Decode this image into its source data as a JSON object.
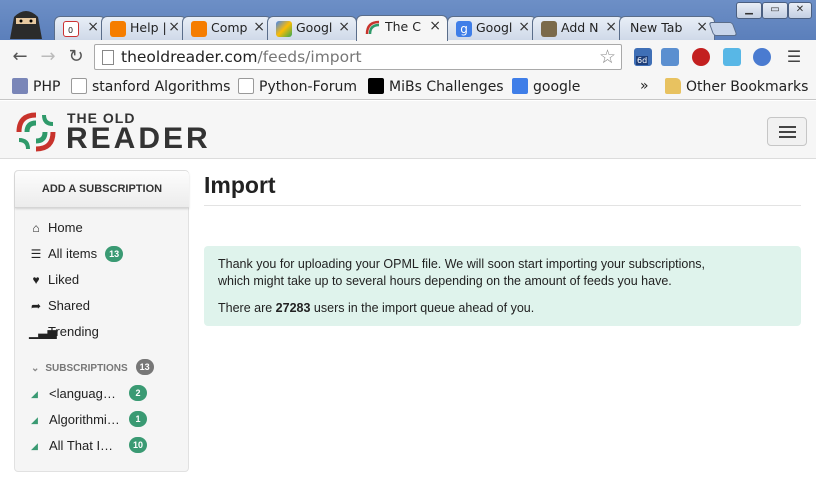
{
  "browser": {
    "tabs": [
      {
        "label": "",
        "favicon": "gmail-icon",
        "badge": "0"
      },
      {
        "label": "Help |",
        "favicon": "blogger-icon"
      },
      {
        "label": "Comp",
        "favicon": "blogger-icon"
      },
      {
        "label": "Googl",
        "favicon": "google-drive-icon"
      },
      {
        "label": "The C",
        "favicon": "oldreader-icon",
        "active": true
      },
      {
        "label": "Googl",
        "favicon": "google-icon"
      },
      {
        "label": "Add N",
        "favicon": "avatar-icon"
      },
      {
        "label": "New Tab",
        "favicon": ""
      }
    ],
    "url_host": "theoldreader.com",
    "url_path": "/feeds/import",
    "extension_badge": "6d",
    "bookmarks": [
      {
        "label": "PHP",
        "icon": "php-icon"
      },
      {
        "label": "stanford Algorithms",
        "icon": "stanford-icon"
      },
      {
        "label": "Python-Forum",
        "icon": "python-icon"
      },
      {
        "label": "MiBs Challenges",
        "icon": "mibs-icon"
      },
      {
        "label": "google",
        "icon": "google-icon"
      }
    ],
    "bookmarks_overflow": "»",
    "other_bookmarks": "Other Bookmarks"
  },
  "header": {
    "logo_small": "THE OLD",
    "logo_big": "READER"
  },
  "sidebar": {
    "add_subscription": "ADD A SUBSCRIPTION",
    "nav": [
      {
        "label": "Home",
        "icon": "home-icon"
      },
      {
        "label": "All items",
        "icon": "list-icon",
        "count": "13"
      },
      {
        "label": "Liked",
        "icon": "heart-icon"
      },
      {
        "label": "Shared",
        "icon": "share-icon"
      },
      {
        "label": "Trending",
        "icon": "signal-icon"
      }
    ],
    "subscriptions_label": "SUBSCRIPTIONS",
    "subscriptions_count": "13",
    "subscriptions": [
      {
        "label": "<languag…",
        "count": "2"
      },
      {
        "label": "Algorithmi…",
        "count": "1"
      },
      {
        "label": "All That I…",
        "count": "10"
      }
    ]
  },
  "main": {
    "title": "Import",
    "notice_line1": "Thank you for uploading your OPML file. We will soon start importing your subscriptions,",
    "notice_line2": "which might take up to several hours depending on the amount of feeds you have.",
    "queue_prefix": "There are ",
    "queue_count": "27283",
    "queue_suffix": " users in the import queue ahead of you."
  },
  "colors": {
    "accent_green": "#3a9a73",
    "notice_bg": "#dff3ec",
    "logo_red": "#c8332c",
    "logo_green": "#2f9a6a"
  }
}
